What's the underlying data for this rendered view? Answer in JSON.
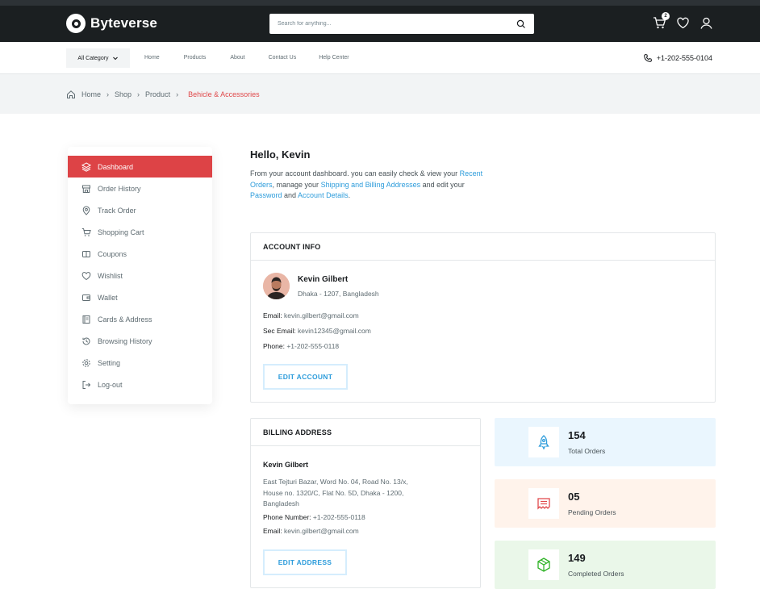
{
  "brand": {
    "name": "Byteverse"
  },
  "search": {
    "placeholder": "Search for anything..."
  },
  "cart": {
    "count": "2"
  },
  "nav": {
    "category": "All Category",
    "links": [
      "Home",
      "Products",
      "About",
      "Contact Us",
      "Help Center"
    ],
    "phone": "+1-202-555-0104"
  },
  "breadcrumb": [
    "Home",
    "Shop",
    "Product",
    "Behicle & Accessories"
  ],
  "sidebar": {
    "items": [
      {
        "label": "Dashboard",
        "icon": "layers-icon"
      },
      {
        "label": "Order History",
        "icon": "store-icon"
      },
      {
        "label": "Track Order",
        "icon": "map-pin-icon"
      },
      {
        "label": "Shopping Cart",
        "icon": "cart-icon"
      },
      {
        "label": "Coupons",
        "icon": "coupon-icon"
      },
      {
        "label": "Wishlist",
        "icon": "heart-icon"
      },
      {
        "label": "Wallet",
        "icon": "wallet-icon"
      },
      {
        "label": "Cards & Address",
        "icon": "notebook-icon"
      },
      {
        "label": "Browsing History",
        "icon": "history-icon"
      },
      {
        "label": "Setting",
        "icon": "gear-icon"
      },
      {
        "label": "Log-out",
        "icon": "logout-icon"
      }
    ]
  },
  "greeting": {
    "title": "Hello, Kevin",
    "t1": "From your account dashboard. you can easily check & view your ",
    "link1": "Recent Orders",
    "t2": ", manage your ",
    "link2": "Shipping and Billing Addresses",
    "t3": " and edit your ",
    "link3": "Password",
    "t4": " and ",
    "link4": "Account Details",
    "t5": "."
  },
  "account": {
    "heading": "ACCOUNT INFO",
    "name": "Kevin Gilbert",
    "location": "Dhaka - 1207, Bangladesh",
    "email_label": "Email:",
    "email": "kevin.gilbert@gmail.com",
    "sec_email_label": "Sec Email:",
    "sec_email": "kevin12345@gmail.com",
    "phone_label": "Phone:",
    "phone": "+1-202-555-0118",
    "button": "EDIT ACCOUNT"
  },
  "billing": {
    "heading": "BILLING ADDRESS",
    "name": "Kevin Gilbert",
    "address": "East Tejturi Bazar, Word No. 04, Road No. 13/x, House no. 1320/C, Flat No. 5D, Dhaka - 1200, Bangladesh",
    "phone_label": "Phone Number:",
    "phone": "+1-202-555-0118",
    "email_label": "Email:",
    "email": "kevin.gilbert@gmail.com",
    "button": "EDIT ADDRESS"
  },
  "stats": [
    {
      "value": "154",
      "label": "Total Orders",
      "bg": "#eaf6fe",
      "icon": "rocket-icon",
      "color": "#2d9cdb"
    },
    {
      "value": "05",
      "label": "Pending Orders",
      "bg": "#fff3eb",
      "icon": "receipt-icon",
      "color": "#e0484a"
    },
    {
      "value": "149",
      "label": "Completed Orders",
      "bg": "#eaf7e9",
      "icon": "package-icon",
      "color": "#2db224"
    }
  ],
  "colors": {
    "accent": "#dd4346",
    "link": "#2d9cdb",
    "header": "#1b1f21"
  }
}
